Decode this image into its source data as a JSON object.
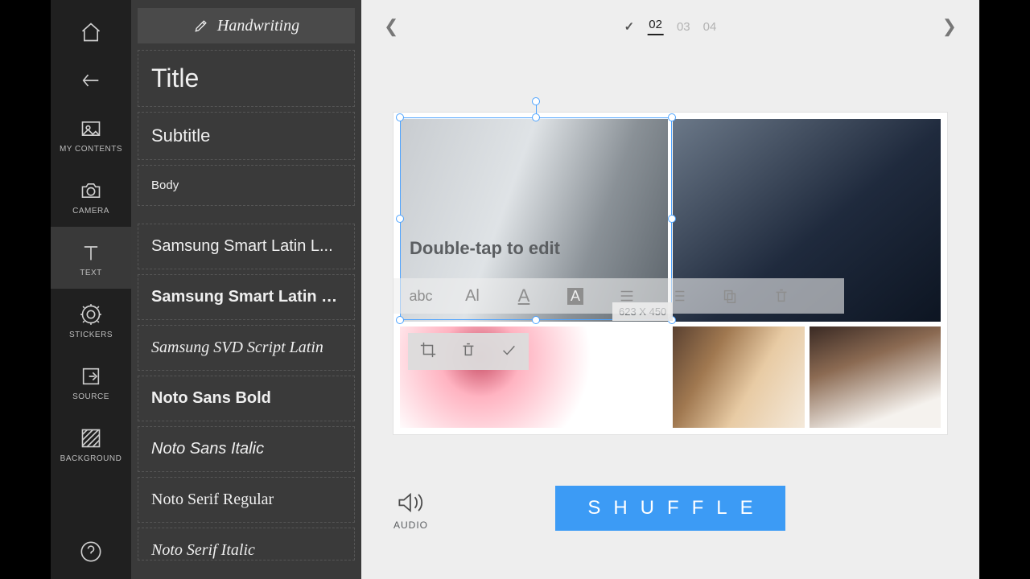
{
  "rail": {
    "items": [
      {
        "id": "home",
        "label": ""
      },
      {
        "id": "back",
        "label": ""
      },
      {
        "id": "my-contents",
        "label": "MY CONTENTS"
      },
      {
        "id": "camera",
        "label": "CAMERA"
      },
      {
        "id": "text",
        "label": "TEXT"
      },
      {
        "id": "stickers",
        "label": "STICKERS"
      },
      {
        "id": "source",
        "label": "SOURCE"
      },
      {
        "id": "background",
        "label": "BACKGROUND"
      }
    ],
    "active": "text"
  },
  "panel": {
    "header": "Handwriting",
    "styles": {
      "title": "Title",
      "subtitle": "Subtitle",
      "body": "Body"
    },
    "fonts": [
      "Samsung Smart Latin L...",
      "Samsung Smart Latin B...",
      "Samsung SVD Script Latin",
      "Noto Sans Bold",
      "Noto Sans Italic",
      "Noto Serif Regular",
      "Noto Serif Italic"
    ]
  },
  "pager": {
    "pages": [
      "02",
      "03",
      "04"
    ],
    "active": "02"
  },
  "editor": {
    "placeholder_text": "Double-tap to edit",
    "dimensions": "623 X 450",
    "text_toolbar": {
      "case": "abc",
      "mixed": "Al",
      "aa": "A",
      "aa2": "A"
    }
  },
  "bottom": {
    "audio_label": "AUDIO",
    "shuffle_label": "SHUFFLE"
  }
}
